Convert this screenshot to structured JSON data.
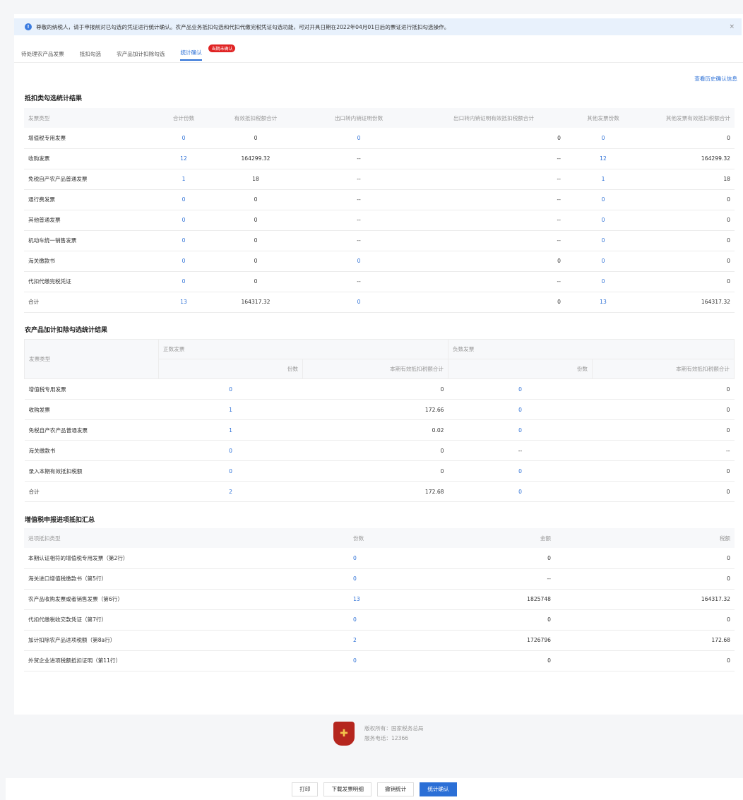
{
  "notice": {
    "text": "尊敬的纳税人，请于申报前对已勾选的凭证进行统计确认。农产品业务抵扣勾选和代扣代缴完税凭证勾选功能，可对开具日期在2022年04月01日后的票证进行抵扣勾选操作。",
    "close": "×"
  },
  "tabs": [
    {
      "label": "待处理农产品发票"
    },
    {
      "label": "抵扣勾选"
    },
    {
      "label": "农产品加计扣除勾选"
    },
    {
      "label": "统计确认",
      "badge": "当期未确认"
    }
  ],
  "history_link": "查看历史确认信息",
  "section1": {
    "title": "抵扣类勾选统计结果",
    "headers": [
      "发票类型",
      "合计份数",
      "有效抵扣税额合计",
      "出口转内销证明份数",
      "出口转内销证明有效抵扣税额合计",
      "其他发票份数",
      "其他发票有效抵扣税额合计"
    ],
    "rows": [
      [
        "增值税专用发票",
        "0",
        "0",
        "0",
        "0",
        "0",
        "0"
      ],
      [
        "收购发票",
        "12",
        "164299.32",
        "--",
        "--",
        "12",
        "164299.32"
      ],
      [
        "免税自产农产品普通发票",
        "1",
        "18",
        "--",
        "--",
        "1",
        "18"
      ],
      [
        "通行费发票",
        "0",
        "0",
        "--",
        "--",
        "0",
        "0"
      ],
      [
        "其他普通发票",
        "0",
        "0",
        "--",
        "--",
        "0",
        "0"
      ],
      [
        "机动车统一销售发票",
        "0",
        "0",
        "--",
        "--",
        "0",
        "0"
      ],
      [
        "海关缴款书",
        "0",
        "0",
        "0",
        "0",
        "0",
        "0"
      ],
      [
        "代扣代缴完税凭证",
        "0",
        "0",
        "--",
        "--",
        "0",
        "0"
      ],
      [
        "合计",
        "13",
        "164317.32",
        "0",
        "0",
        "13",
        "164317.32"
      ]
    ]
  },
  "section2": {
    "title": "农产品加计扣除勾选统计结果",
    "head_type": "发票类型",
    "head_pos": "正数发票",
    "head_neg": "负数发票",
    "head_count": "份数",
    "head_tax": "本期有效抵扣税额合计",
    "rows": [
      [
        "增值税专用发票",
        "0",
        "0",
        "0",
        "0"
      ],
      [
        "收购发票",
        "1",
        "172.66",
        "0",
        "0"
      ],
      [
        "免税自产农产品普通发票",
        "1",
        "0.02",
        "0",
        "0"
      ],
      [
        "海关缴款书",
        "0",
        "0",
        "--",
        "--"
      ],
      [
        "录入本期有效抵扣税额",
        "0",
        "0",
        "0",
        "0"
      ],
      [
        "合计",
        "2",
        "172.68",
        "0",
        "0"
      ]
    ]
  },
  "section3": {
    "title": "增值税申报进项抵扣汇总",
    "headers": [
      "进项抵扣类型",
      "份数",
      "金额",
      "税额"
    ],
    "rows": [
      [
        "本期认证相符的增值税专用发票（第2行）",
        "0",
        "0",
        "0"
      ],
      [
        "海关进口增值税缴款书（第5行）",
        "0",
        "--",
        "0"
      ],
      [
        "农产品收购发票或者销售发票（第6行）",
        "13",
        "1825748",
        "164317.32"
      ],
      [
        "代扣代缴税收交款凭证（第7行）",
        "0",
        "0",
        "0"
      ],
      [
        "加计扣除农产品进项税额（第8a行）",
        "2",
        "1726796",
        "172.68"
      ],
      [
        "外贸企业进项税额抵扣证明（第11行）",
        "0",
        "0",
        "0"
      ]
    ]
  },
  "footer": {
    "copyright": "版权所有：国家税务总局",
    "phone": "服务电话：12366"
  },
  "buttons": {
    "print": "打印",
    "download": "下载发票明细",
    "revoke": "撤销统计",
    "confirm": "统计确认"
  }
}
